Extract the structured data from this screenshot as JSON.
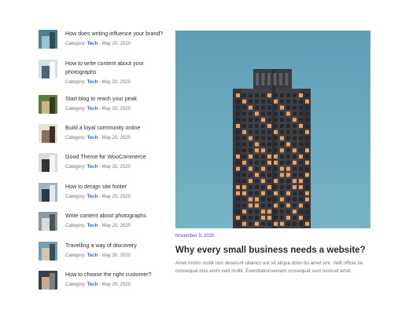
{
  "posts": [
    {
      "title": "How does writing influence your brand?",
      "category_label": "Category:",
      "category": "Tech",
      "separator": "-",
      "date": "May 20, 2020",
      "thumb": "building-icon"
    },
    {
      "title": "How to write content about your photographs",
      "category_label": "Category:",
      "category": "Tech",
      "separator": "-",
      "date": "May 20, 2020",
      "thumb": "skyscraper-icon"
    },
    {
      "title": "Start blog to reach your peak",
      "category_label": "Category:",
      "category": "Tech",
      "separator": "-",
      "date": "May 20, 2020",
      "thumb": "plants-icon"
    },
    {
      "title": "Build a loyal community online",
      "category_label": "Category:",
      "category": "Tech",
      "separator": "-",
      "date": "May 20, 2020",
      "thumb": "person-icon"
    },
    {
      "title": "Good Theme for WooCommerce",
      "category_label": "Category:",
      "category": "Tech",
      "separator": "-",
      "date": "May 20, 2020",
      "thumb": "laptop-icon"
    },
    {
      "title": "How to design site footer",
      "category_label": "Category:",
      "category": "Tech",
      "separator": "-",
      "date": "May 20, 2020",
      "thumb": "tower-icon"
    },
    {
      "title": "Write content about photographs",
      "category_label": "Category:",
      "category": "Tech",
      "separator": "-",
      "date": "May 20, 2020",
      "thumb": "road-icon"
    },
    {
      "title": "Travelling a way of discovery",
      "category_label": "Category:",
      "category": "Tech",
      "separator": "-",
      "date": "May 20, 2020",
      "thumb": "stadium-icon"
    },
    {
      "title": "How to choose the right customer?",
      "category_label": "Category:",
      "category": "Tech",
      "separator": "-",
      "date": "May 20, 2020",
      "thumb": "crowd-icon"
    }
  ],
  "featured": {
    "date": "November 9, 2020",
    "title": "Why every small business needs a website?",
    "excerpt": "Amet minim mollit non deserunt ullamco est sit aliqua dolor do amet sint. Velit officia ire consequat duis enim velit mollit. Exercitationveniam consequat sunt nostrud amet.",
    "image": "skyscraper-photo"
  },
  "colors": {
    "accent": "#2563eb",
    "date_accent": "#4f46e5",
    "sky": "#6aa7bd"
  }
}
